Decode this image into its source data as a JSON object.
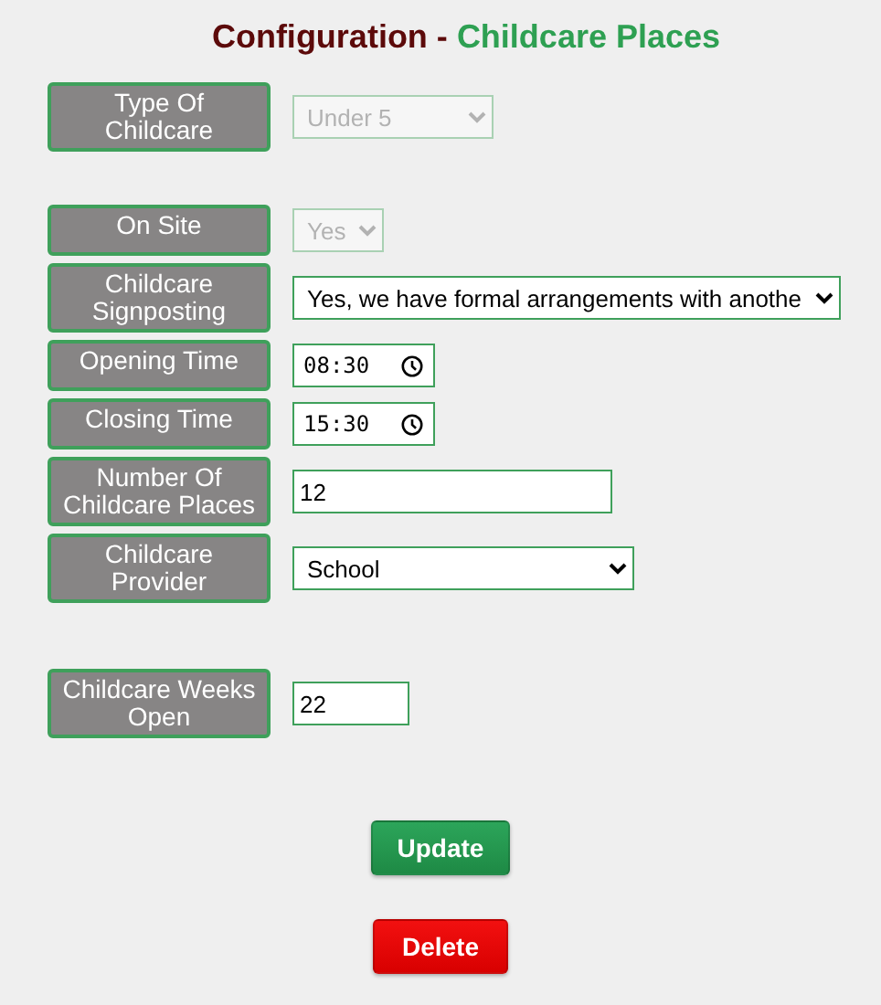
{
  "title": {
    "prefix": "Configuration - ",
    "highlight": "Childcare Places"
  },
  "fields": [
    {
      "label": "Type Of Childcare",
      "kind": "select",
      "value": "Under 5",
      "disabled": true
    },
    {
      "label": "On Site",
      "kind": "select",
      "value": "Yes",
      "disabled": true
    },
    {
      "label": "Childcare Signposting",
      "kind": "select",
      "value": "Yes, we have formal arrangements with anothe",
      "disabled": false
    },
    {
      "label": "Opening Time",
      "kind": "time",
      "value": "08:30",
      "disabled": false
    },
    {
      "label": "Closing Time",
      "kind": "time",
      "value": "15:30",
      "disabled": false
    },
    {
      "label": "Number Of Childcare Places",
      "kind": "text",
      "value": "12",
      "disabled": false
    },
    {
      "label": "Childcare Provider",
      "kind": "select",
      "value": "School",
      "disabled": false
    },
    {
      "label": "Childcare Weeks Open",
      "kind": "text",
      "value": "22",
      "disabled": false
    }
  ],
  "buttons": [
    {
      "label": "Update",
      "kind": "primary"
    },
    {
      "label": "Delete",
      "kind": "danger"
    }
  ]
}
